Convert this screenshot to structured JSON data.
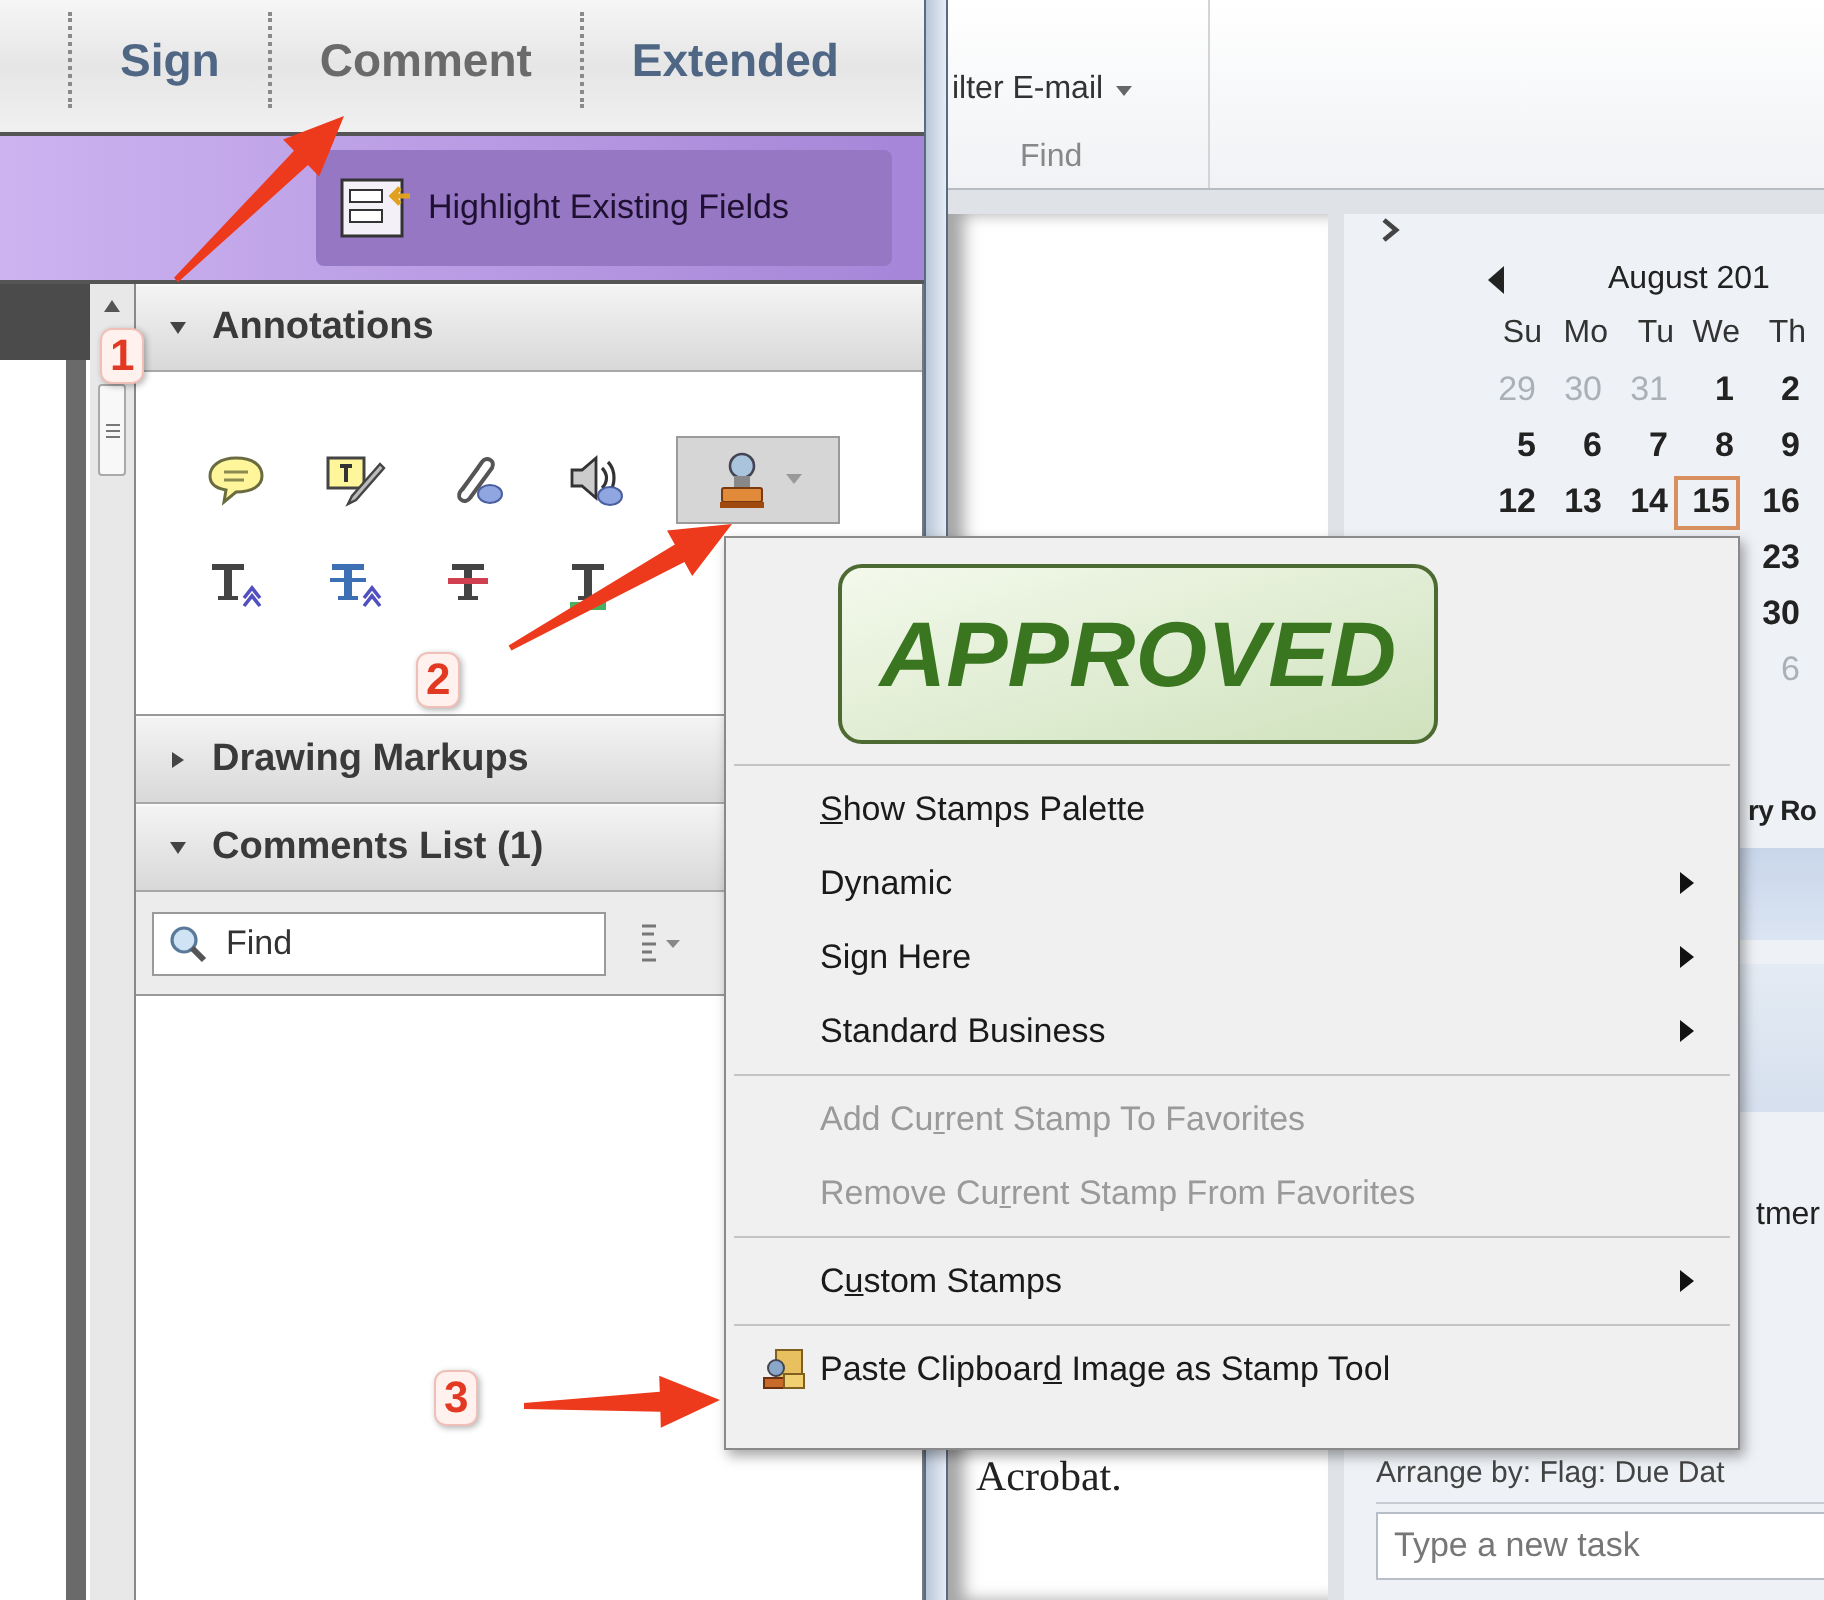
{
  "acrobat": {
    "tabs": [
      {
        "label": "Sign",
        "selected": false
      },
      {
        "label": "Comment",
        "selected": true
      },
      {
        "label": "Extended",
        "selected": false
      }
    ],
    "highlight_button": {
      "label": "Highlight Existing Fields"
    },
    "sections": [
      {
        "kind": "tools",
        "title": "Annotations",
        "expanded": true,
        "tool_rows": [
          [
            {
              "kind": "note",
              "selected": false
            },
            {
              "kind": "text-note",
              "selected": false
            },
            {
              "kind": "attach",
              "selected": false
            },
            {
              "kind": "sound",
              "selected": false
            },
            {
              "kind": "stamp",
              "selected": true
            }
          ],
          [
            {
              "kind": "insert-text",
              "selected": false
            },
            {
              "kind": "replace-text",
              "selected": false
            },
            {
              "kind": "strikethrough",
              "selected": false
            },
            {
              "kind": "underline",
              "selected": false
            }
          ]
        ]
      },
      {
        "kind": "plain",
        "title": "Drawing Markups",
        "expanded": false
      },
      {
        "kind": "comments",
        "title": "Comments List (1)",
        "expanded": true,
        "search": {
          "placeholder": "Find"
        }
      }
    ]
  },
  "outlook": {
    "ribbon": {
      "filter_button": "ilter E-mail",
      "group_label": "Find"
    },
    "reading_pane": {
      "text": "Acrobat."
    },
    "calendar": {
      "month": "August 201",
      "weekdays": [
        "Su",
        "Mo",
        "Tu",
        "We",
        "Th"
      ],
      "weeks": [
        [
          {
            "day": "29",
            "muted": true,
            "today": false
          },
          {
            "day": "30",
            "muted": true,
            "today": false
          },
          {
            "day": "31",
            "muted": true,
            "today": false
          },
          {
            "day": "1",
            "muted": false,
            "today": false
          },
          {
            "day": "2",
            "muted": false,
            "today": false
          }
        ],
        [
          {
            "day": "5",
            "muted": false,
            "today": false
          },
          {
            "day": "6",
            "muted": false,
            "today": false
          },
          {
            "day": "7",
            "muted": false,
            "today": false
          },
          {
            "day": "8",
            "muted": false,
            "today": false
          },
          {
            "day": "9",
            "muted": false,
            "today": false
          }
        ],
        [
          {
            "day": "12",
            "muted": false,
            "today": false
          },
          {
            "day": "13",
            "muted": false,
            "today": false
          },
          {
            "day": "14",
            "muted": false,
            "today": false
          },
          {
            "day": "15",
            "muted": false,
            "today": true
          },
          {
            "day": "16",
            "muted": false,
            "today": false
          }
        ],
        [
          {
            "day": "23",
            "muted": false,
            "today": false
          }
        ],
        [
          {
            "day": "30",
            "muted": false,
            "today": false
          }
        ],
        [
          {
            "day": "6",
            "muted": true,
            "today": false
          }
        ]
      ]
    },
    "todo": {
      "heading_fragment": "ry Ro",
      "item_fragment": "tmer",
      "arrange_label": "Arrange by: Flag: Due Dat",
      "new_task": {
        "placeholder": "Type a new task"
      }
    }
  },
  "stamp_menu": {
    "preview": "APPROVED",
    "groups": [
      [
        {
          "kind": "text",
          "key": "S",
          "after": "how Stamps Palette",
          "submenu": false,
          "disabled": false
        },
        {
          "kind": "text",
          "label": "Dynamic",
          "submenu": true,
          "disabled": false
        },
        {
          "kind": "text",
          "label": "Sign Here",
          "submenu": true,
          "disabled": false
        },
        {
          "kind": "text",
          "label": "Standard Business",
          "submenu": true,
          "disabled": false
        }
      ],
      [
        {
          "kind": "text",
          "before": "Add Cu",
          "key": "r",
          "after": "rent Stamp To Favorites",
          "submenu": false,
          "disabled": true
        },
        {
          "kind": "text",
          "before": "Remove Cu",
          "key": "r",
          "after": "rent Stamp From Favorites",
          "submenu": false,
          "disabled": true
        }
      ],
      [
        {
          "kind": "text",
          "before": "C",
          "key": "u",
          "after": "stom Stamps",
          "submenu": true,
          "disabled": false
        }
      ],
      [
        {
          "kind": "icon",
          "before": "Paste Clipboar",
          "key": "d",
          "after": " Image as Stamp Tool",
          "submenu": false,
          "disabled": false
        }
      ]
    ]
  },
  "callouts": [
    {
      "number": "1"
    },
    {
      "number": "2"
    },
    {
      "number": "3"
    }
  ]
}
